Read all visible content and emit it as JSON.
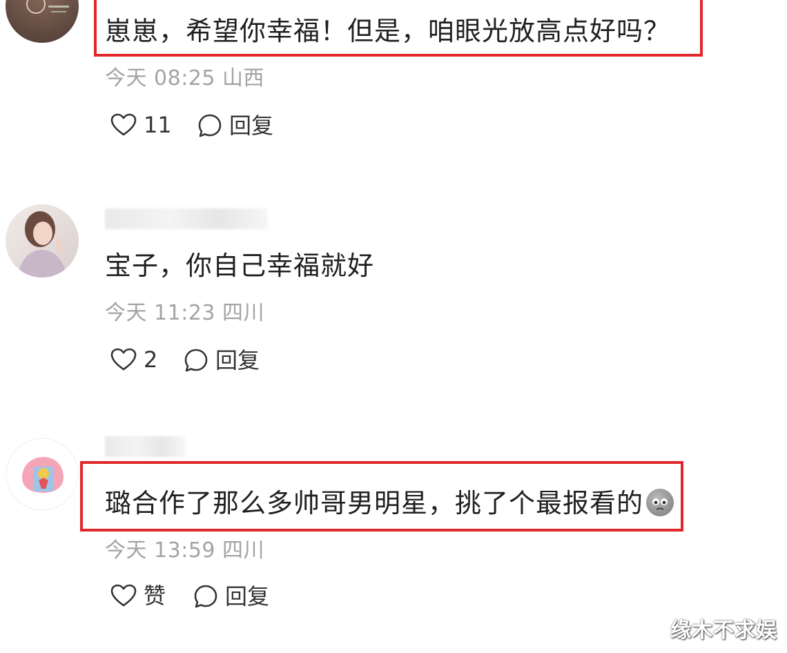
{
  "comments": [
    {
      "text": "崽崽，希望你幸福！但是，咱眼光放高点好吗？",
      "time": "今天 08:25",
      "location": "山西",
      "likes": "11",
      "reply": "回复",
      "highlighted": true
    },
    {
      "text": "宝子，你自己幸福就好",
      "time": "今天 11:23",
      "location": "四川",
      "likes": "2",
      "reply": "回复",
      "highlighted": false
    },
    {
      "text": "璐合作了那么多帅哥男明星，挑了个最报看的",
      "time": "今天 13:59",
      "location": "四川",
      "likes": "赞",
      "reply": "回复",
      "highlighted": true
    }
  ],
  "watermark": "缘木不求娱",
  "icons": {
    "like": "heart-outline-icon",
    "reply": "speech-bubble-icon",
    "sticker": "gray-face-emoji-icon"
  },
  "colors": {
    "highlight": "#e0262a",
    "meta": "#a3a3a3",
    "text": "#1f1f1f"
  }
}
